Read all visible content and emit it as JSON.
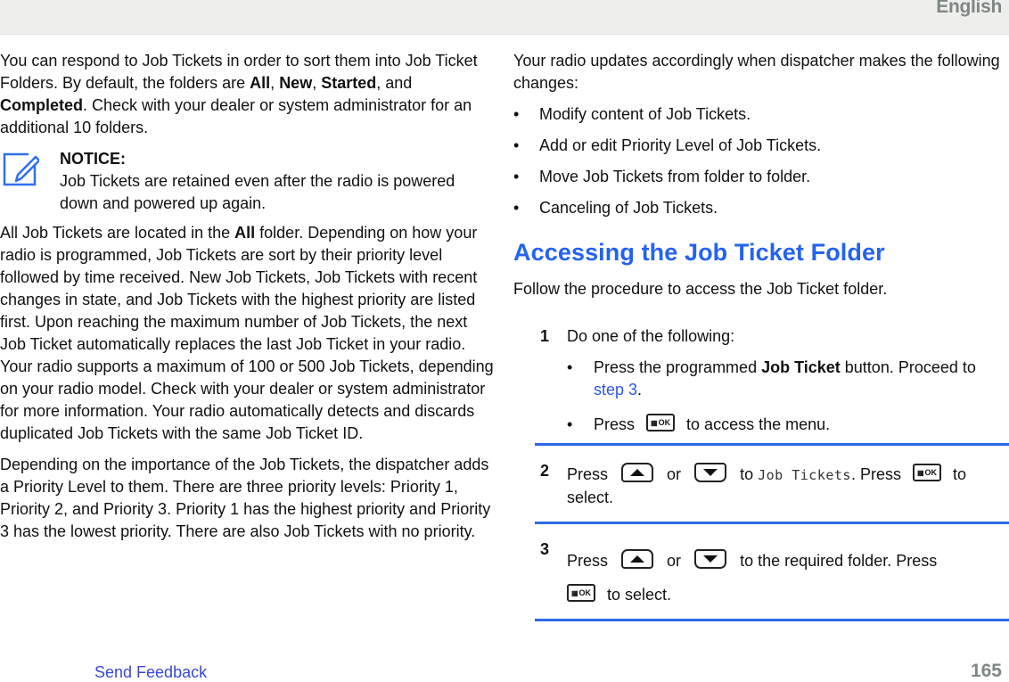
{
  "header": {
    "language": "English"
  },
  "left_column": {
    "intro": {
      "text_1": "You can respond to Job Tickets in order to sort them into Job Ticket Folders. By default, the folders are ",
      "folder_all": "All",
      "sep_1": ", ",
      "folder_new": "New",
      "sep_2": ", ",
      "folder_started": "Started",
      "sep_3": ", and ",
      "folder_completed": "Completed",
      "text_2": ". Check with your dealer or system administrator for an additional 10 folders."
    },
    "notice": {
      "icon": "pencil-edit-icon",
      "title": "NOTICE:",
      "body": "Job Tickets are retained even after the radio is powered down and powered up again."
    },
    "paragraph_2": {
      "text_1": "All Job Tickets are located in the ",
      "bold": "All",
      "text_2": " folder. Depending on how your radio is programmed, Job Tickets are sort by their priority level followed by time received. New Job Tickets, Job Tickets with recent changes in state, and Job Tickets with the highest priority are listed first. Upon reaching the maximum number of Job Tickets, the next Job Ticket automatically replaces the last Job Ticket in your radio. Your radio supports a maximum of 100 or 500 Job Tickets, depending on your radio model. Check with your dealer or system administrator for more information. Your radio automatically detects and discards duplicated Job Tickets with the same Job Ticket ID."
    },
    "paragraph_3": "Depending on the importance of the Job Tickets, the dispatcher adds a Priority Level to them. There are three priority levels: Priority 1, Priority 2, and Priority 3. Priority 1 has the highest priority and Priority 3 has the lowest priority. There are also Job Tickets with no priority."
  },
  "right_column": {
    "intro": "Your radio updates accordingly when dispatcher makes the following changes:",
    "bullet_char": "•",
    "changes": [
      "Modify content of Job Tickets.",
      "Add or edit Priority Level of Job Tickets.",
      "Move Job Tickets from folder to folder.",
      "Canceling of Job Tickets."
    ],
    "section_title": "Accessing the Job Ticket Folder",
    "section_intro": "Follow the procedure to access the Job Ticket folder.",
    "steps": [
      {
        "number": "1",
        "text": "Do one of the following:",
        "option_1": {
          "text_1": "Press the programmed ",
          "bold": "Job Ticket",
          "text_2": " button. Proceed to ",
          "link": "step 3",
          "text_3": "."
        },
        "option_2": {
          "text_1": "Press",
          "key": "ok-menu-key-icon",
          "text_2": "to access the menu."
        }
      },
      {
        "number": "2",
        "press": "Press",
        "key_up": "up-arrow-key-icon",
        "or": "or",
        "key_down": "down-arrow-key-icon",
        "to": "to",
        "display_text": "Job Tickets",
        "text_after": ". Press",
        "key_ok": "ok-menu-key-icon",
        "text_end": "to select."
      },
      {
        "number": "3",
        "press": "Press",
        "key_up": "up-arrow-key-icon",
        "or": "or",
        "key_down": "down-arrow-key-icon",
        "text_after": "to the required folder. Press",
        "key_ok": "ok-menu-key-icon",
        "text_end": "to select."
      }
    ],
    "ok_key_label": "OK",
    "ok_key_grid": "▦"
  },
  "footer": {
    "feedback_link": "Send Feedback",
    "page_number": "165"
  },
  "colors": {
    "heading_blue": "#2462f0",
    "rule_blue": "#2d6ae6",
    "link_blue": "#3a47d4",
    "header_gray": "#7f8784",
    "topbar_bg": "#eeeeec"
  }
}
